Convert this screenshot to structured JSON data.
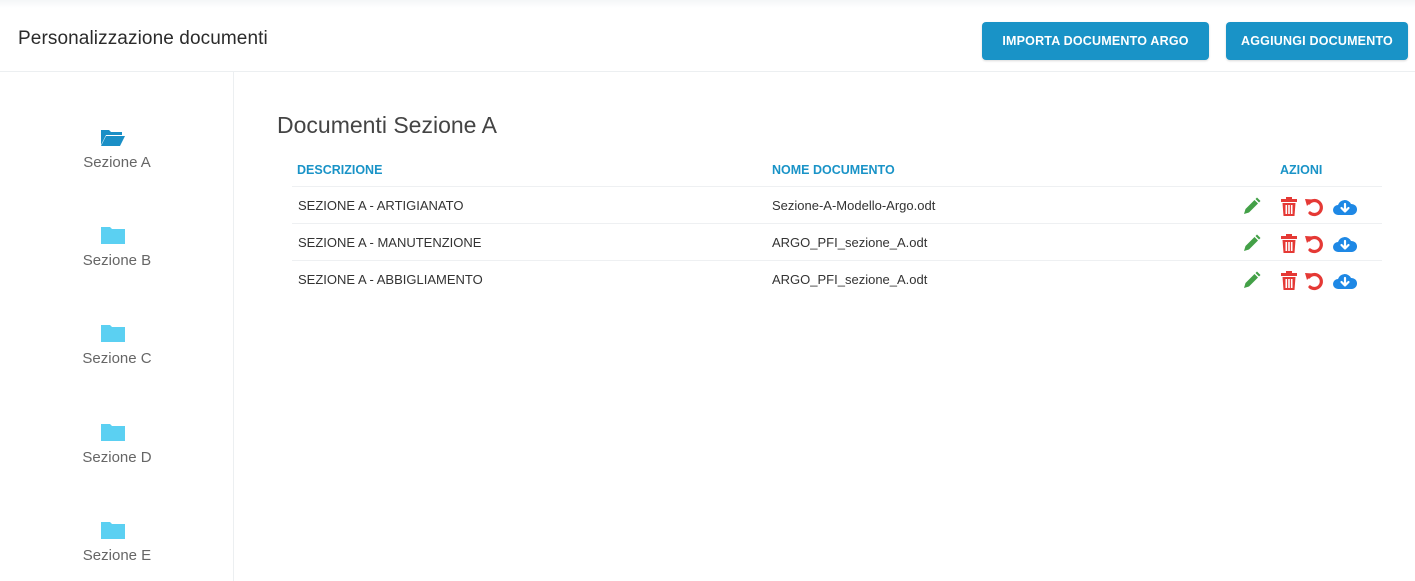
{
  "header": {
    "title": "Personalizzazione documenti",
    "import_button": "IMPORTA DOCUMENTO ARGO",
    "add_button": "AGGIUNGI DOCUMENTO"
  },
  "sidebar": {
    "items": [
      {
        "label": "Sezione A",
        "icon": "folder-open-icon",
        "active": true
      },
      {
        "label": "Sezione B",
        "icon": "folder-icon",
        "active": false
      },
      {
        "label": "Sezione C",
        "icon": "folder-icon",
        "active": false
      },
      {
        "label": "Sezione D",
        "icon": "folder-icon",
        "active": false
      },
      {
        "label": "Sezione E",
        "icon": "folder-icon",
        "active": false
      }
    ]
  },
  "main": {
    "title": "Documenti Sezione A",
    "columns": {
      "description": "DESCRIZIONE",
      "document_name": "NOME DOCUMENTO",
      "actions": "AZIONI"
    },
    "rows": [
      {
        "description": "SEZIONE A - ARTIGIANATO",
        "document_name": "Sezione-A-Modello-Argo.odt"
      },
      {
        "description": "SEZIONE A - MANUTENZIONE",
        "document_name": "ARGO_PFI_sezione_A.odt"
      },
      {
        "description": "SEZIONE A - ABBIGLIAMENTO",
        "document_name": "ARGO_PFI_sezione_A.odt"
      }
    ],
    "row_actions": [
      "pencil-icon",
      "trash-icon",
      "undo-icon",
      "cloud-download-icon"
    ]
  },
  "colors": {
    "accent": "#1993c7",
    "folder_active": "#1a8fc6",
    "folder_inactive": "#5bd0f2",
    "edit": "#43a047",
    "danger": "#e53935",
    "download": "#1e88e5"
  }
}
